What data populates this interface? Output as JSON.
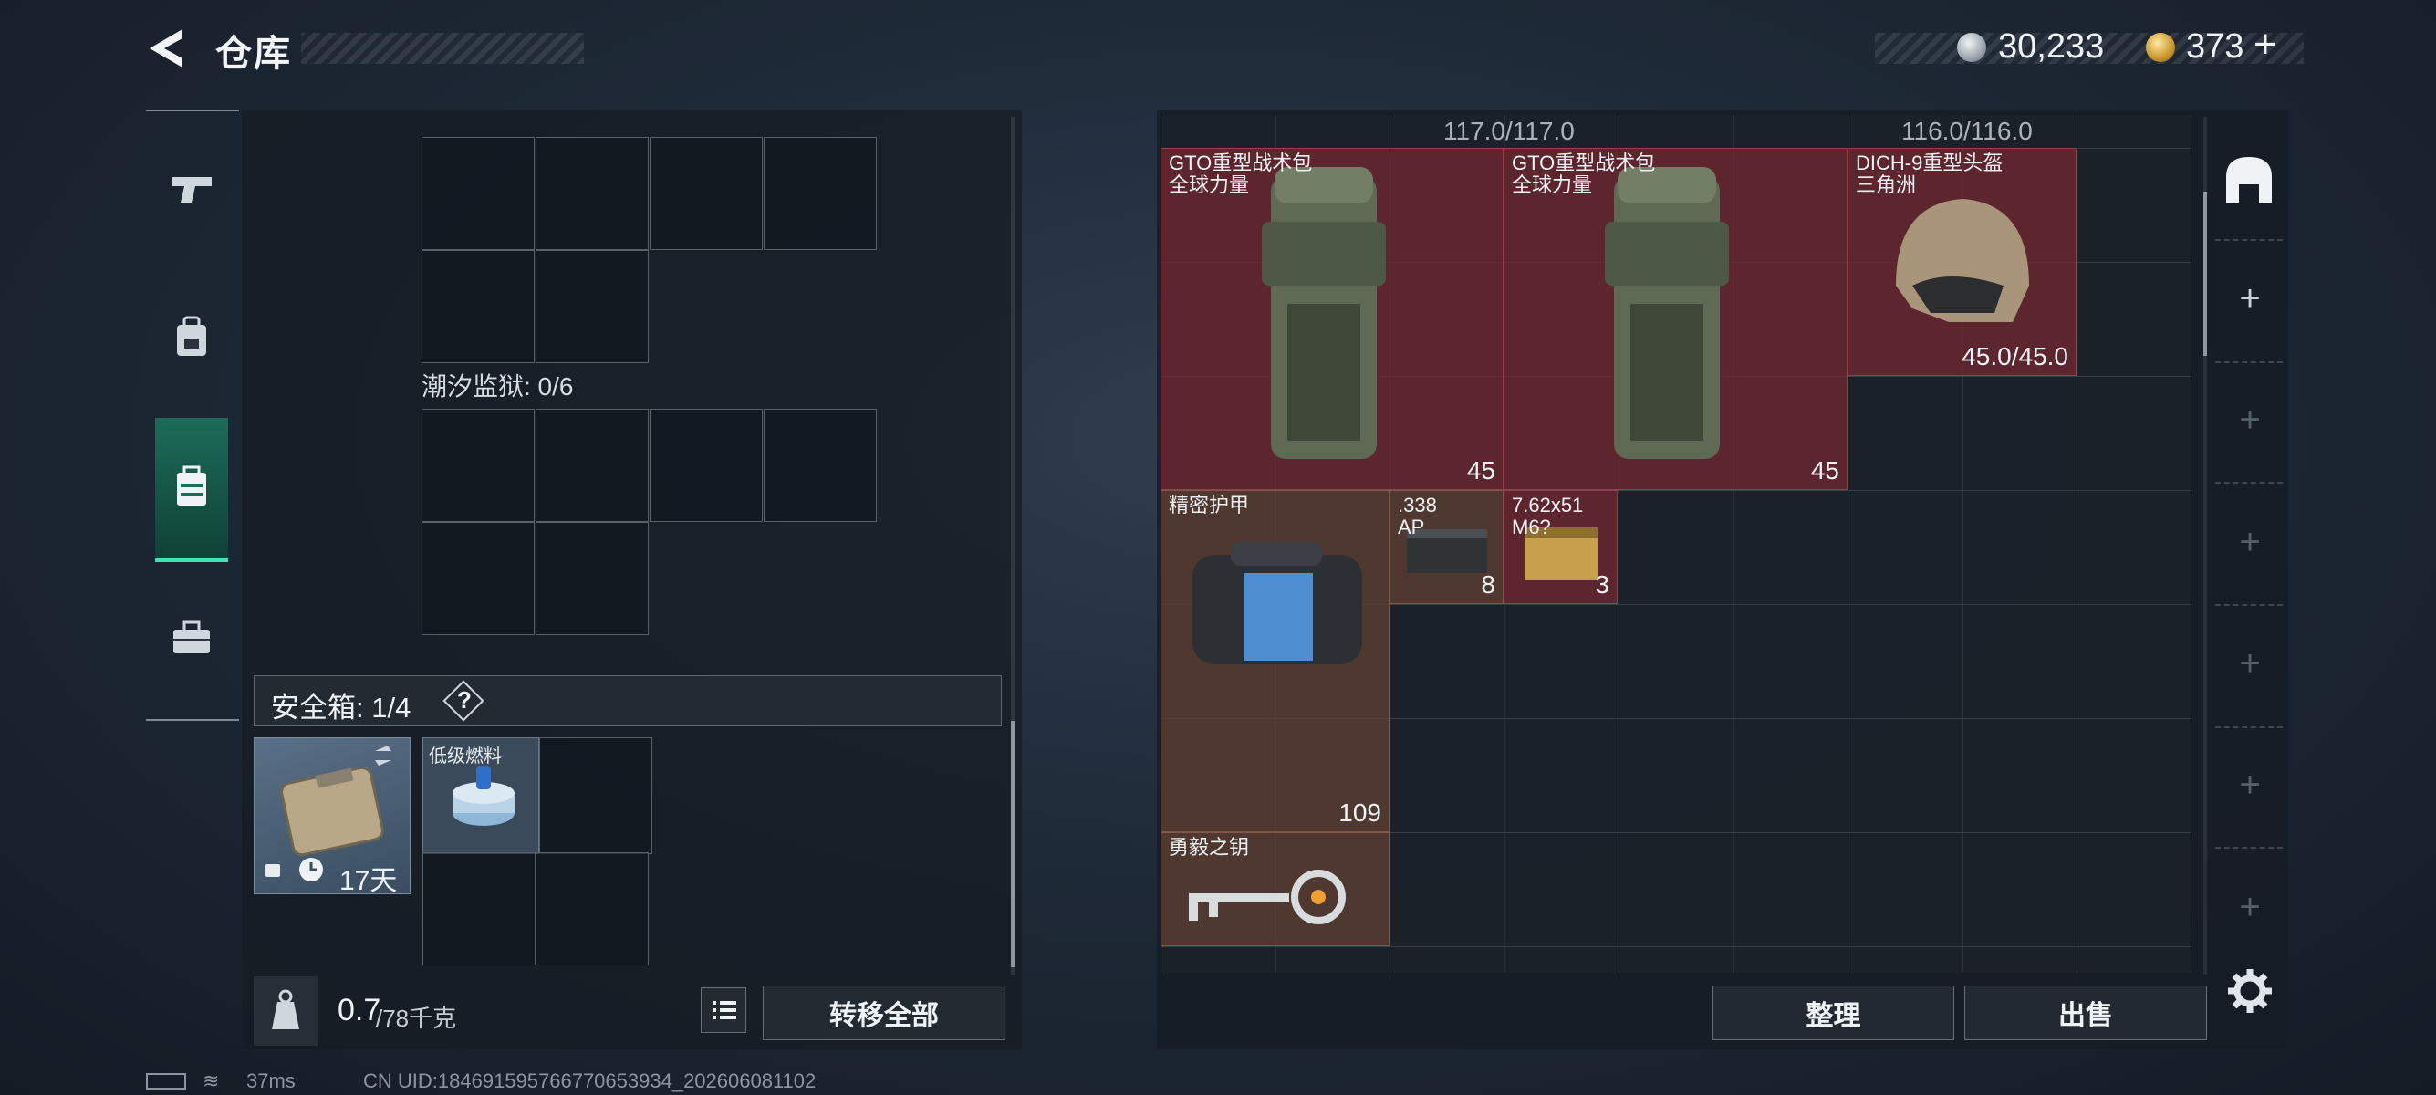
{
  "header": {
    "title": "仓库",
    "currency_silver": "30,233",
    "currency_gold": "373",
    "add_label": "+"
  },
  "left": {
    "section_tide": "潮汐监狱: 0/6",
    "safe_box_label": "安全箱: 1/4",
    "safe_box_help": "?",
    "safe_box_days": "17天",
    "fuel_item": "低级燃料",
    "weight_value": "0.7",
    "weight_unit": "/78千克",
    "transfer_all": "转移全部"
  },
  "stash": {
    "durability_1": "117.0/117.0",
    "durability_2": "116.0/116.0",
    "items": [
      {
        "name": "GTO重型战术包",
        "sub": "全球力量",
        "count": "45"
      },
      {
        "name": "GTO重型战术包",
        "sub": "全球力量",
        "count": "45"
      },
      {
        "name": "DICH-9重型头盔",
        "sub": "三角洲",
        "count": "45.0/45.0"
      },
      {
        "name": "精密护甲",
        "sub": "",
        "count": "109"
      },
      {
        "name": ".338",
        "sub": "AP",
        "count": "8"
      },
      {
        "name": "7.62x51",
        "sub": "M6?",
        "count": "3"
      },
      {
        "name": "勇毅之钥",
        "sub": "",
        "count": ""
      }
    ],
    "tidy": "整理",
    "sell": "出售"
  },
  "status": {
    "ping": "37ms",
    "uid": "CN UID:18469159576677065393​4_202606081102"
  },
  "colors": {
    "accent": "#43e3b1",
    "item_red": "#6e2830",
    "item_brown": "#5c3e32"
  }
}
